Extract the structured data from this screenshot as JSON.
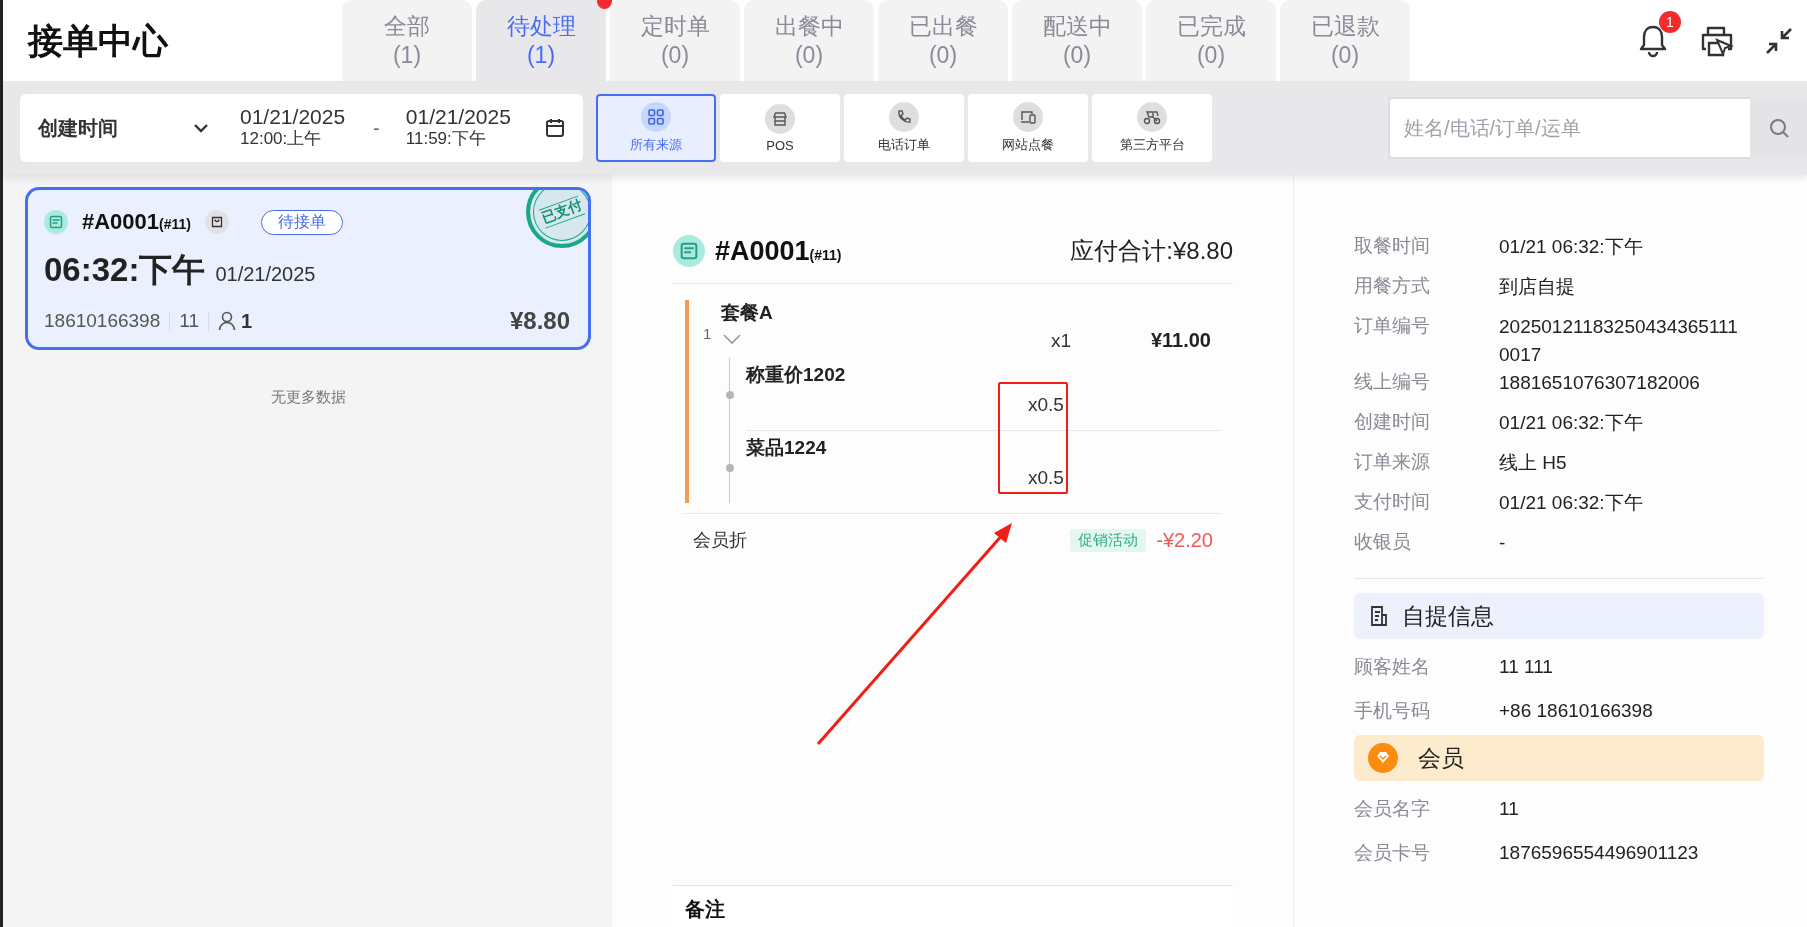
{
  "header": {
    "title": "接单中心",
    "bell_badge": "1"
  },
  "tabs": [
    {
      "label": "全部",
      "count": "(1)",
      "selected": false,
      "dot": false
    },
    {
      "label": "待处理",
      "count": "(1)",
      "selected": true,
      "dot": true
    },
    {
      "label": "定时单",
      "count": "(0)",
      "selected": false,
      "dot": false
    },
    {
      "label": "出餐中",
      "count": "(0)",
      "selected": false,
      "dot": false
    },
    {
      "label": "已出餐",
      "count": "(0)",
      "selected": false,
      "dot": false
    },
    {
      "label": "配送中",
      "count": "(0)",
      "selected": false,
      "dot": false
    },
    {
      "label": "已完成",
      "count": "(0)",
      "selected": false,
      "dot": false
    },
    {
      "label": "已退款",
      "count": "(0)",
      "selected": false,
      "dot": false
    }
  ],
  "filter": {
    "field": "创建时间",
    "start_date": "01/21/2025",
    "start_time": "12:00:上午",
    "separator": "-",
    "end_date": "01/21/2025",
    "end_time": "11:59:下午"
  },
  "sources": [
    {
      "label": "所有来源",
      "kind": "grid",
      "selected": true
    },
    {
      "label": "POS",
      "kind": "store",
      "selected": false
    },
    {
      "label": "电话订单",
      "kind": "phone",
      "selected": false
    },
    {
      "label": "网站点餐",
      "kind": "devices",
      "selected": false
    },
    {
      "label": "第三方平台",
      "kind": "scooter",
      "selected": false
    }
  ],
  "search": {
    "placeholder": "姓名/电话/订单/运单"
  },
  "orders": [
    {
      "number": "#A0001",
      "sub": "(#11)",
      "status": "待接单",
      "stamp": "已支付",
      "time": "06:32:下午",
      "date": "01/21/2025",
      "phone": "18610166398",
      "table": "11",
      "guests": "1",
      "total": "¥8.80",
      "selected": true
    }
  ],
  "list_end": "无更多数据",
  "detail": {
    "number": "#A0001",
    "sub": "(#11)",
    "total": "应付合计:¥8.80",
    "items": [
      {
        "index": "1",
        "name": "套餐A",
        "qty": "x1",
        "price": "¥11.00",
        "children": [
          {
            "name": "称重价1202",
            "qty": "x0.5"
          },
          {
            "name": "菜品1224",
            "qty": "x0.5"
          }
        ]
      }
    ],
    "discounts": [
      {
        "label": "会员折",
        "tag": "促销活动",
        "amount": "-¥2.20"
      }
    ],
    "remark_title": "备注"
  },
  "info": {
    "fields": [
      {
        "label": "取餐时间",
        "value": "01/21 06:32:下午"
      },
      {
        "label": "用餐方式",
        "value": "到店自提"
      },
      {
        "label": "订单编号",
        "value": "202501211832504343651110017"
      },
      {
        "label": "线上编号",
        "value": "1881651076307182006"
      },
      {
        "label": "创建时间",
        "value": "01/21 06:32:下午"
      },
      {
        "label": "订单来源",
        "value": "线上 H5"
      },
      {
        "label": "支付时间",
        "value": "01/21 06:32:下午"
      },
      {
        "label": "收银员",
        "value": "-"
      }
    ],
    "sections": [
      {
        "kind": "pickup",
        "title": "自提信息",
        "fields": [
          {
            "label": "顾客姓名",
            "value": "11 111"
          },
          {
            "label": "手机号码",
            "value": "+86 18610166398"
          }
        ]
      },
      {
        "kind": "member",
        "title": "会员",
        "fields": [
          {
            "label": "会员名字",
            "value": "11"
          },
          {
            "label": "会员卡号",
            "value": "1876596554496901123"
          }
        ]
      }
    ]
  }
}
